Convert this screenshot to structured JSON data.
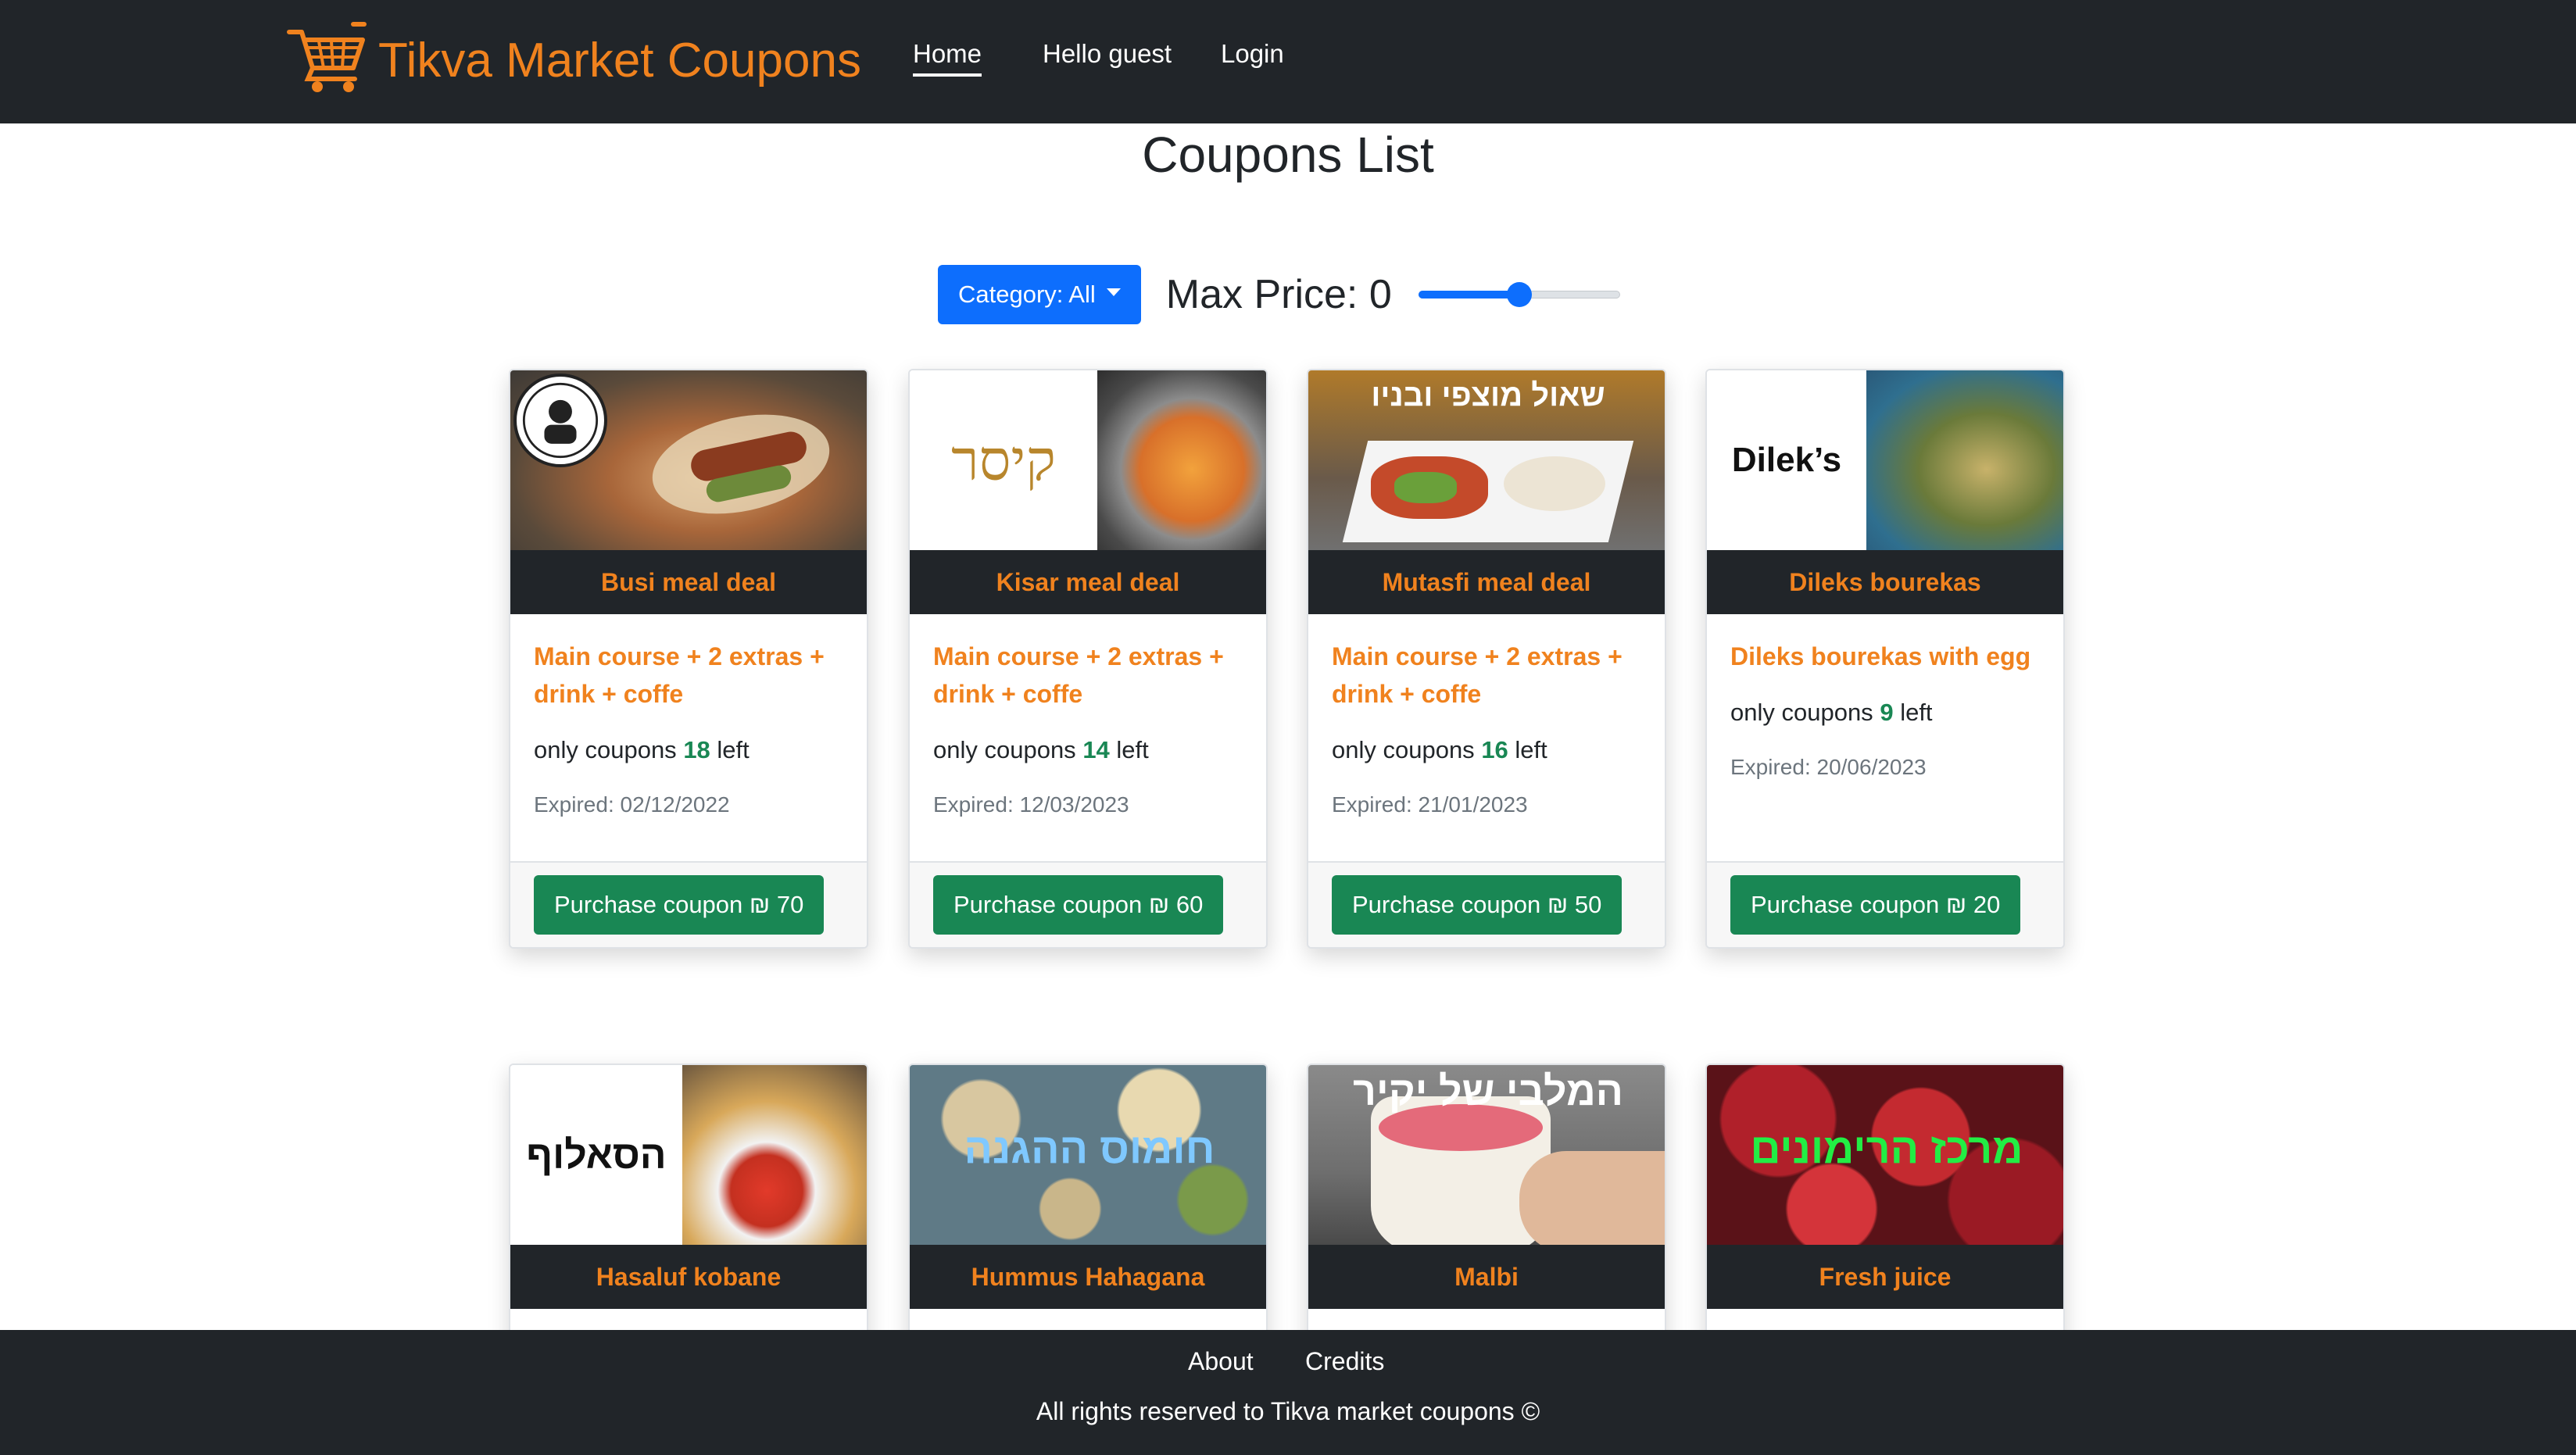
{
  "nav": {
    "brand": "Tikva Market Coupons",
    "links": [
      "Home",
      "Hello guest",
      "Login"
    ]
  },
  "page": {
    "title": "Coupons List"
  },
  "filters": {
    "category_label": "Category: All",
    "max_price_label": "Max Price: 0",
    "slider_level": 0.5
  },
  "colors": {
    "accent": "#f0821e",
    "dark": "#212529",
    "primary": "#0d6efd",
    "success": "#198754"
  },
  "coupons": [
    {
      "title": "Busi meal deal",
      "description": "Main course + 2 extras + drink + coffe",
      "count_prefix": "only coupons",
      "count": "18",
      "count_suffix": "left",
      "expired": "Expired: 02/12/2022",
      "button": "Purchase coupon ₪ 70",
      "image_text": ""
    },
    {
      "title": "Kisar meal deal",
      "description": "Main course + 2 extras + drink + coffe",
      "count_prefix": "only coupons",
      "count": "14",
      "count_suffix": "left",
      "expired": "Expired: 12/03/2023",
      "button": "Purchase coupon ₪ 60",
      "image_text": "קיסר"
    },
    {
      "title": "Mutasfi meal deal",
      "description": "Main course + 2 extras + drink + coffe",
      "count_prefix": "only coupons",
      "count": "16",
      "count_suffix": "left",
      "expired": "Expired: 21/01/2023",
      "button": "Purchase coupon ₪ 50",
      "image_text": "שאול מוצפי ובניו"
    },
    {
      "title": "Dileks bourekas",
      "description": "Dileks bourekas with egg",
      "count_prefix": "only coupons",
      "count": "9",
      "count_suffix": "left",
      "expired": "Expired: 20/06/2023",
      "button": "Purchase coupon ₪ 20",
      "image_text": "Dilek’s"
    },
    {
      "title": "Hasaluf kobane",
      "image_text": "הסאלוף"
    },
    {
      "title": "Hummus Hahagana",
      "image_text": "חומוס ההגנה"
    },
    {
      "title": "Malbi",
      "image_text": "המלבי של יקיר"
    },
    {
      "title": "Fresh juice",
      "image_text": "מרכז הרימונים"
    }
  ],
  "footer": {
    "links": [
      "About",
      "Credits"
    ],
    "copyright": "All rights reserved to Tikva market coupons ©"
  }
}
